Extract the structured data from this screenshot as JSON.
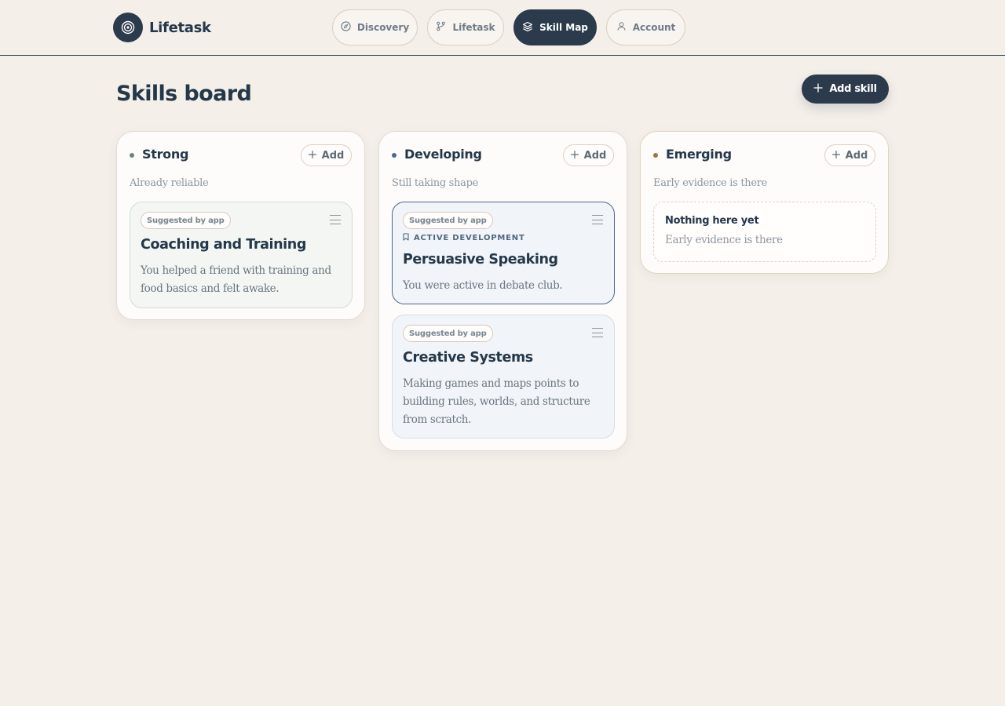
{
  "app": {
    "name": "Lifetask"
  },
  "nav": {
    "tabs": [
      {
        "label": "Discovery",
        "icon": "compass-icon",
        "active": false
      },
      {
        "label": "Lifetask",
        "icon": "branch-icon",
        "active": false
      },
      {
        "label": "Skill Map",
        "icon": "layers-icon",
        "active": true
      },
      {
        "label": "Account",
        "icon": "user-icon",
        "active": false
      }
    ]
  },
  "page": {
    "title": "Skills board",
    "add_skill_label": "Add skill"
  },
  "colors": {
    "primary": "#2b3b4c",
    "background": "#f4efe9",
    "strong_dot": "#6f8577",
    "developing_dot": "#4f6b8a",
    "emerging_dot": "#a3733e"
  },
  "board": {
    "columns": [
      {
        "title": "Strong",
        "subtitle": "Already reliable",
        "add_label": "Add",
        "cards": [
          {
            "badge": "Suggested by app",
            "title": "Coaching and Training",
            "body": "You helped a friend with training and food basics and felt awake."
          }
        ]
      },
      {
        "title": "Developing",
        "subtitle": "Still taking shape",
        "add_label": "Add",
        "cards": [
          {
            "badge": "Suggested by app",
            "flag": "ACTIVE DEVELOPMENT",
            "title": "Persuasive Speaking",
            "body": "You were active in debate club."
          },
          {
            "badge": "Suggested by app",
            "title": "Creative Systems",
            "body": "Making games and maps points to building rules, worlds, and structure from scratch."
          }
        ]
      },
      {
        "title": "Emerging",
        "subtitle": "Early evidence is there",
        "add_label": "Add",
        "empty": {
          "title": "Nothing here yet",
          "subtitle": "Early evidence is there"
        }
      }
    ]
  }
}
